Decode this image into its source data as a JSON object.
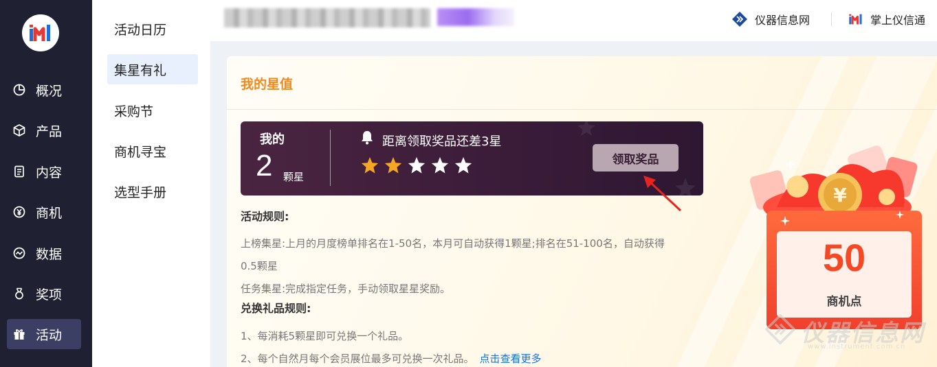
{
  "sidebar": {
    "items": [
      {
        "label": "概况",
        "icon": "pie-chart-icon"
      },
      {
        "label": "产品",
        "icon": "box-icon"
      },
      {
        "label": "内容",
        "icon": "document-icon"
      },
      {
        "label": "商机",
        "icon": "yuan-icon"
      },
      {
        "label": "数据",
        "icon": "trend-icon"
      },
      {
        "label": "奖项",
        "icon": "medal-icon"
      },
      {
        "label": "活动",
        "icon": "gift-icon",
        "active": true
      }
    ]
  },
  "submenu": {
    "items": [
      {
        "label": "活动日历"
      },
      {
        "label": "集星有礼",
        "active": true
      },
      {
        "label": "采购节"
      },
      {
        "label": "商机寻宝"
      },
      {
        "label": "选型手册"
      }
    ]
  },
  "topbar": {
    "link1": "仪器信息网",
    "link2": "掌上仪信通"
  },
  "card": {
    "title": "我的星值",
    "panel": {
      "my_label": "我的",
      "star_count": "2",
      "star_unit": "颗星",
      "message": "距离领取奖品还差3星",
      "stars_filled": 2,
      "stars_total": 5,
      "button": "领取奖品"
    },
    "rules_title": "活动规则:",
    "rule1_line1": "上榜集星:上月的月度榜单排名在1-50名，本月可自动获得1颗星;排名在51-100名，自动获得",
    "rule1_line2": "0.5颗星",
    "rule2": "任务集星:完成指定任务，手动领取星星奖励。",
    "exchange_title": "兑换礼品规则:",
    "exchange1": "1、每消耗5颗星即可兑换一个礼品。",
    "exchange2": "2、每个自然月每个会员展位最多可兑换一次礼品。",
    "more_link": "点击查看更多"
  },
  "coupon": {
    "value": "50",
    "label": "商机点"
  },
  "watermark": {
    "text": "仪器信息网",
    "sub": "www.instrument.com.cn"
  },
  "colors": {
    "sidebar_bg": "#1f2133",
    "accent_orange": "#f08a1c",
    "panel_bg": "#3b1c39",
    "star_gold": "#f5a623",
    "link_blue": "#1e6fd9"
  }
}
